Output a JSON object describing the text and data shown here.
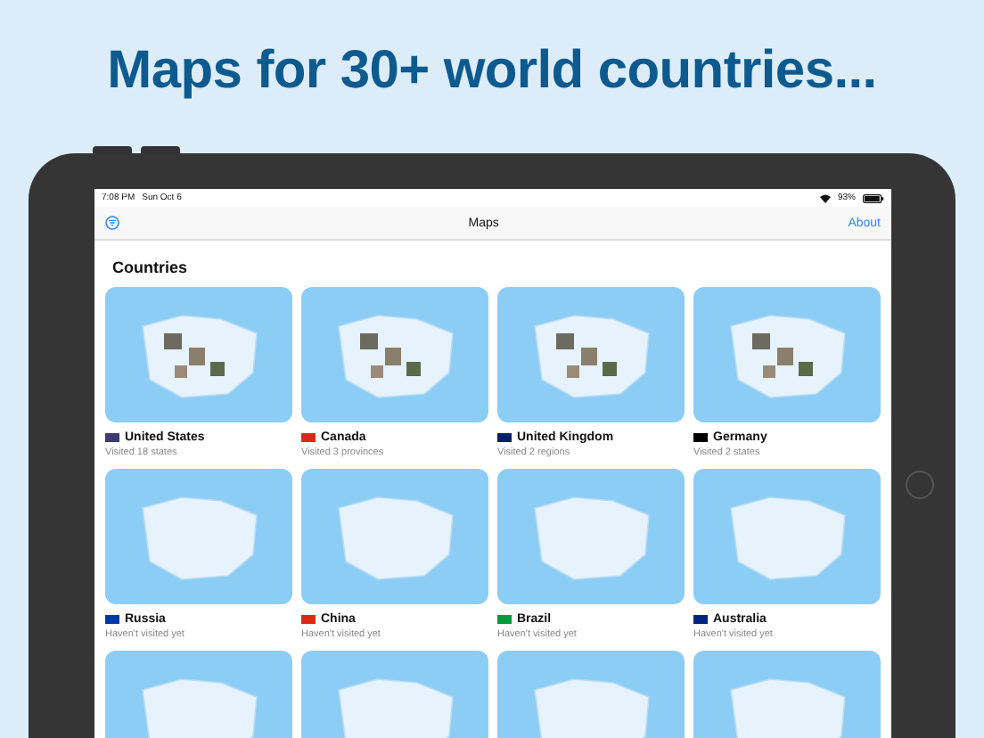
{
  "headline": "Maps for 30+ world countries...",
  "status_bar": {
    "time": "7:08 PM",
    "date": "Sun Oct 6",
    "battery": "93%"
  },
  "nav_bar": {
    "title": "Maps",
    "right_button": "About"
  },
  "section_title": "Countries",
  "countries": [
    {
      "name": "United States",
      "subtitle": "Visited 18 states",
      "color": "#3c3b6e",
      "has_photos": true
    },
    {
      "name": "Canada",
      "subtitle": "Visited 3 provinces",
      "color": "#d52b1e",
      "has_photos": true
    },
    {
      "name": "United Kingdom",
      "subtitle": "Visited 2 regions",
      "color": "#012169",
      "has_photos": true
    },
    {
      "name": "Germany",
      "subtitle": "Visited 2 states",
      "color": "#000000",
      "has_photos": true
    },
    {
      "name": "Russia",
      "subtitle": "Haven't visited yet",
      "color": "#0039a6",
      "has_photos": false
    },
    {
      "name": "China",
      "subtitle": "Haven't visited yet",
      "color": "#de2910",
      "has_photos": false
    },
    {
      "name": "Brazil",
      "subtitle": "Haven't visited yet",
      "color": "#009c3b",
      "has_photos": false
    },
    {
      "name": "Australia",
      "subtitle": "Haven't visited yet",
      "color": "#00247d",
      "has_photos": false
    },
    {
      "has_photos": false
    },
    {
      "has_photos": false
    },
    {
      "has_photos": false
    },
    {
      "has_photos": false
    }
  ]
}
